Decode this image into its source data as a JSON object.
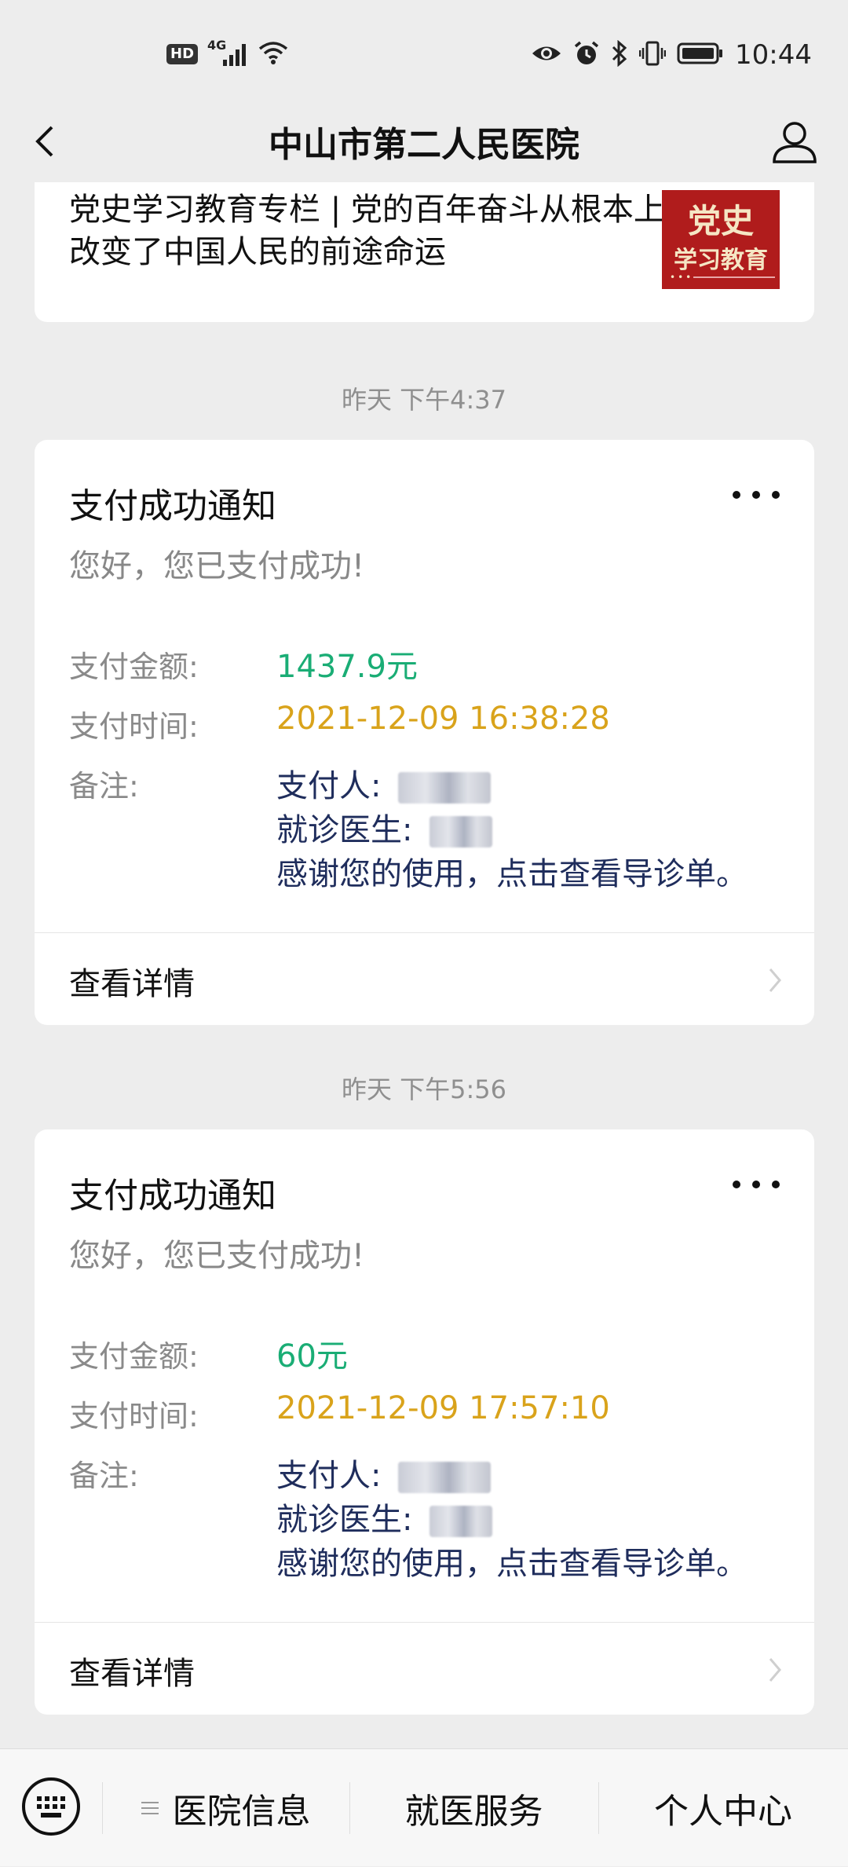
{
  "status_bar": {
    "hd": "HD",
    "network": "4G",
    "time": "10:44"
  },
  "nav": {
    "title": "中山市第二人民医院"
  },
  "article": {
    "text": "党史学习教育专栏 | 党的百年奋斗从根本上改变了中国人民的前途命运",
    "thumb_line1": "党史",
    "thumb_line2": "学习教育"
  },
  "messages": [
    {
      "timestamp": "昨天 下午4:37",
      "title": "支付成功通知",
      "greeting": "您好，您已支付成功!",
      "amount_label": "支付金额:",
      "amount": "1437.9元",
      "time_label": "支付时间:",
      "time": "2021-12-09 16:38:28",
      "note_label": "备注:",
      "payer_label": "支付人:",
      "doctor_label": "就诊医生:",
      "thanks": "感谢您的使用，点击查看导诊单。",
      "detail_label": "查看详情"
    },
    {
      "timestamp": "昨天 下午5:56",
      "title": "支付成功通知",
      "greeting": "您好，您已支付成功!",
      "amount_label": "支付金额:",
      "amount": "60元",
      "time_label": "支付时间:",
      "time": "2021-12-09 17:57:10",
      "note_label": "备注:",
      "payer_label": "支付人:",
      "doctor_label": "就诊医生:",
      "thanks": "感谢您的使用，点击查看导诊单。",
      "detail_label": "查看详情"
    }
  ],
  "bottom_menu": {
    "items": [
      "医院信息",
      "就医服务",
      "个人中心"
    ]
  },
  "colors": {
    "amount": "#1aad75",
    "time": "#d9a31b",
    "note": "#1f2d5c"
  },
  "icons": {
    "back": "chevron-left-icon",
    "profile": "user-icon",
    "more": "more-dots-icon",
    "keyboard": "keyboard-icon",
    "menu": "menu-lines-icon",
    "chevron": "chevron-right-icon"
  }
}
